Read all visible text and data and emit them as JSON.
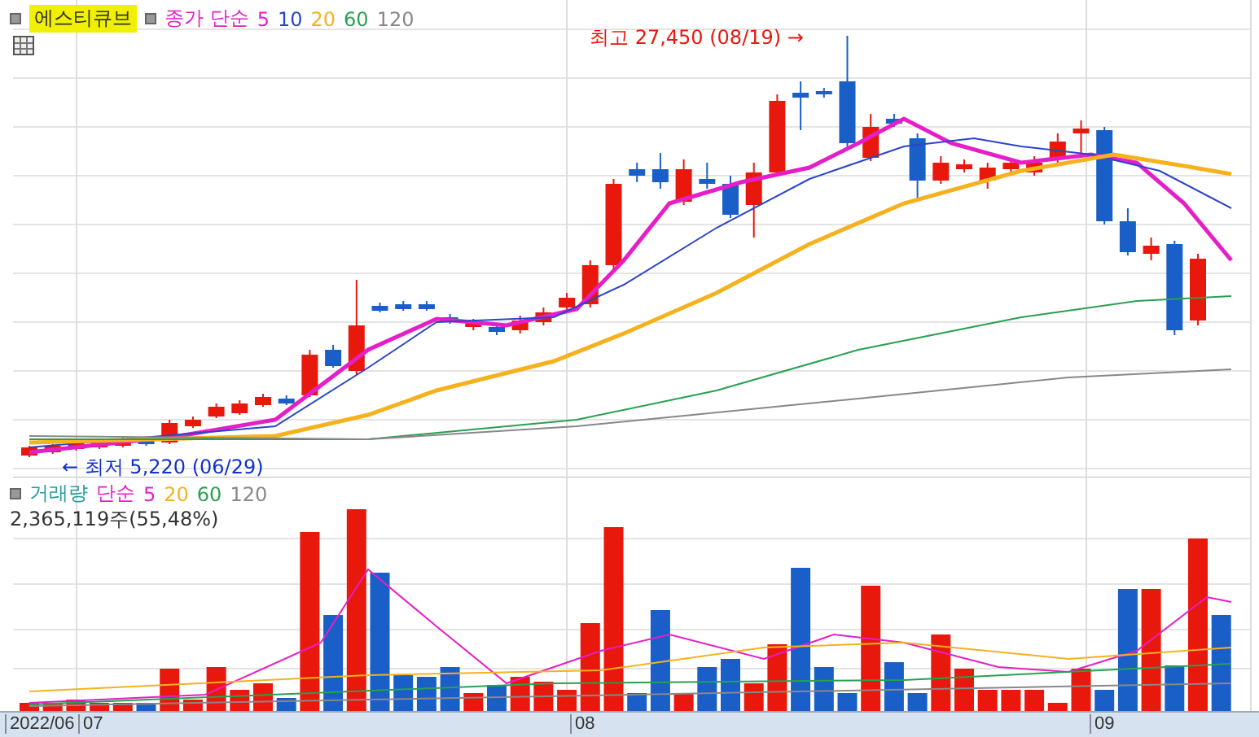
{
  "price_panel": {
    "stock_name": "에스티큐브",
    "indicator": "종가 단순",
    "periods": [
      {
        "label": "5",
        "color": "#e61ec8"
      },
      {
        "label": "10",
        "color": "#2a45c8"
      },
      {
        "label": "20",
        "color": "#f5b21e"
      },
      {
        "label": "60",
        "color": "#28a050"
      },
      {
        "label": "120",
        "color": "#888888"
      }
    ],
    "high_marker": "최고 27,450 (08/19) →",
    "low_marker": "← 최저 5,220 (06/29)"
  },
  "volume_panel": {
    "title": "거래량",
    "indicator": "단순",
    "periods": [
      {
        "label": "5",
        "color": "#e61ec8"
      },
      {
        "label": "20",
        "color": "#f5b21e"
      },
      {
        "label": "60",
        "color": "#28a050"
      },
      {
        "label": "120",
        "color": "#888888"
      }
    ],
    "reading": "2,365,119주(55,48%)"
  },
  "x_axis": {
    "labels": [
      "2022/06",
      "07",
      "08",
      "09"
    ]
  }
}
